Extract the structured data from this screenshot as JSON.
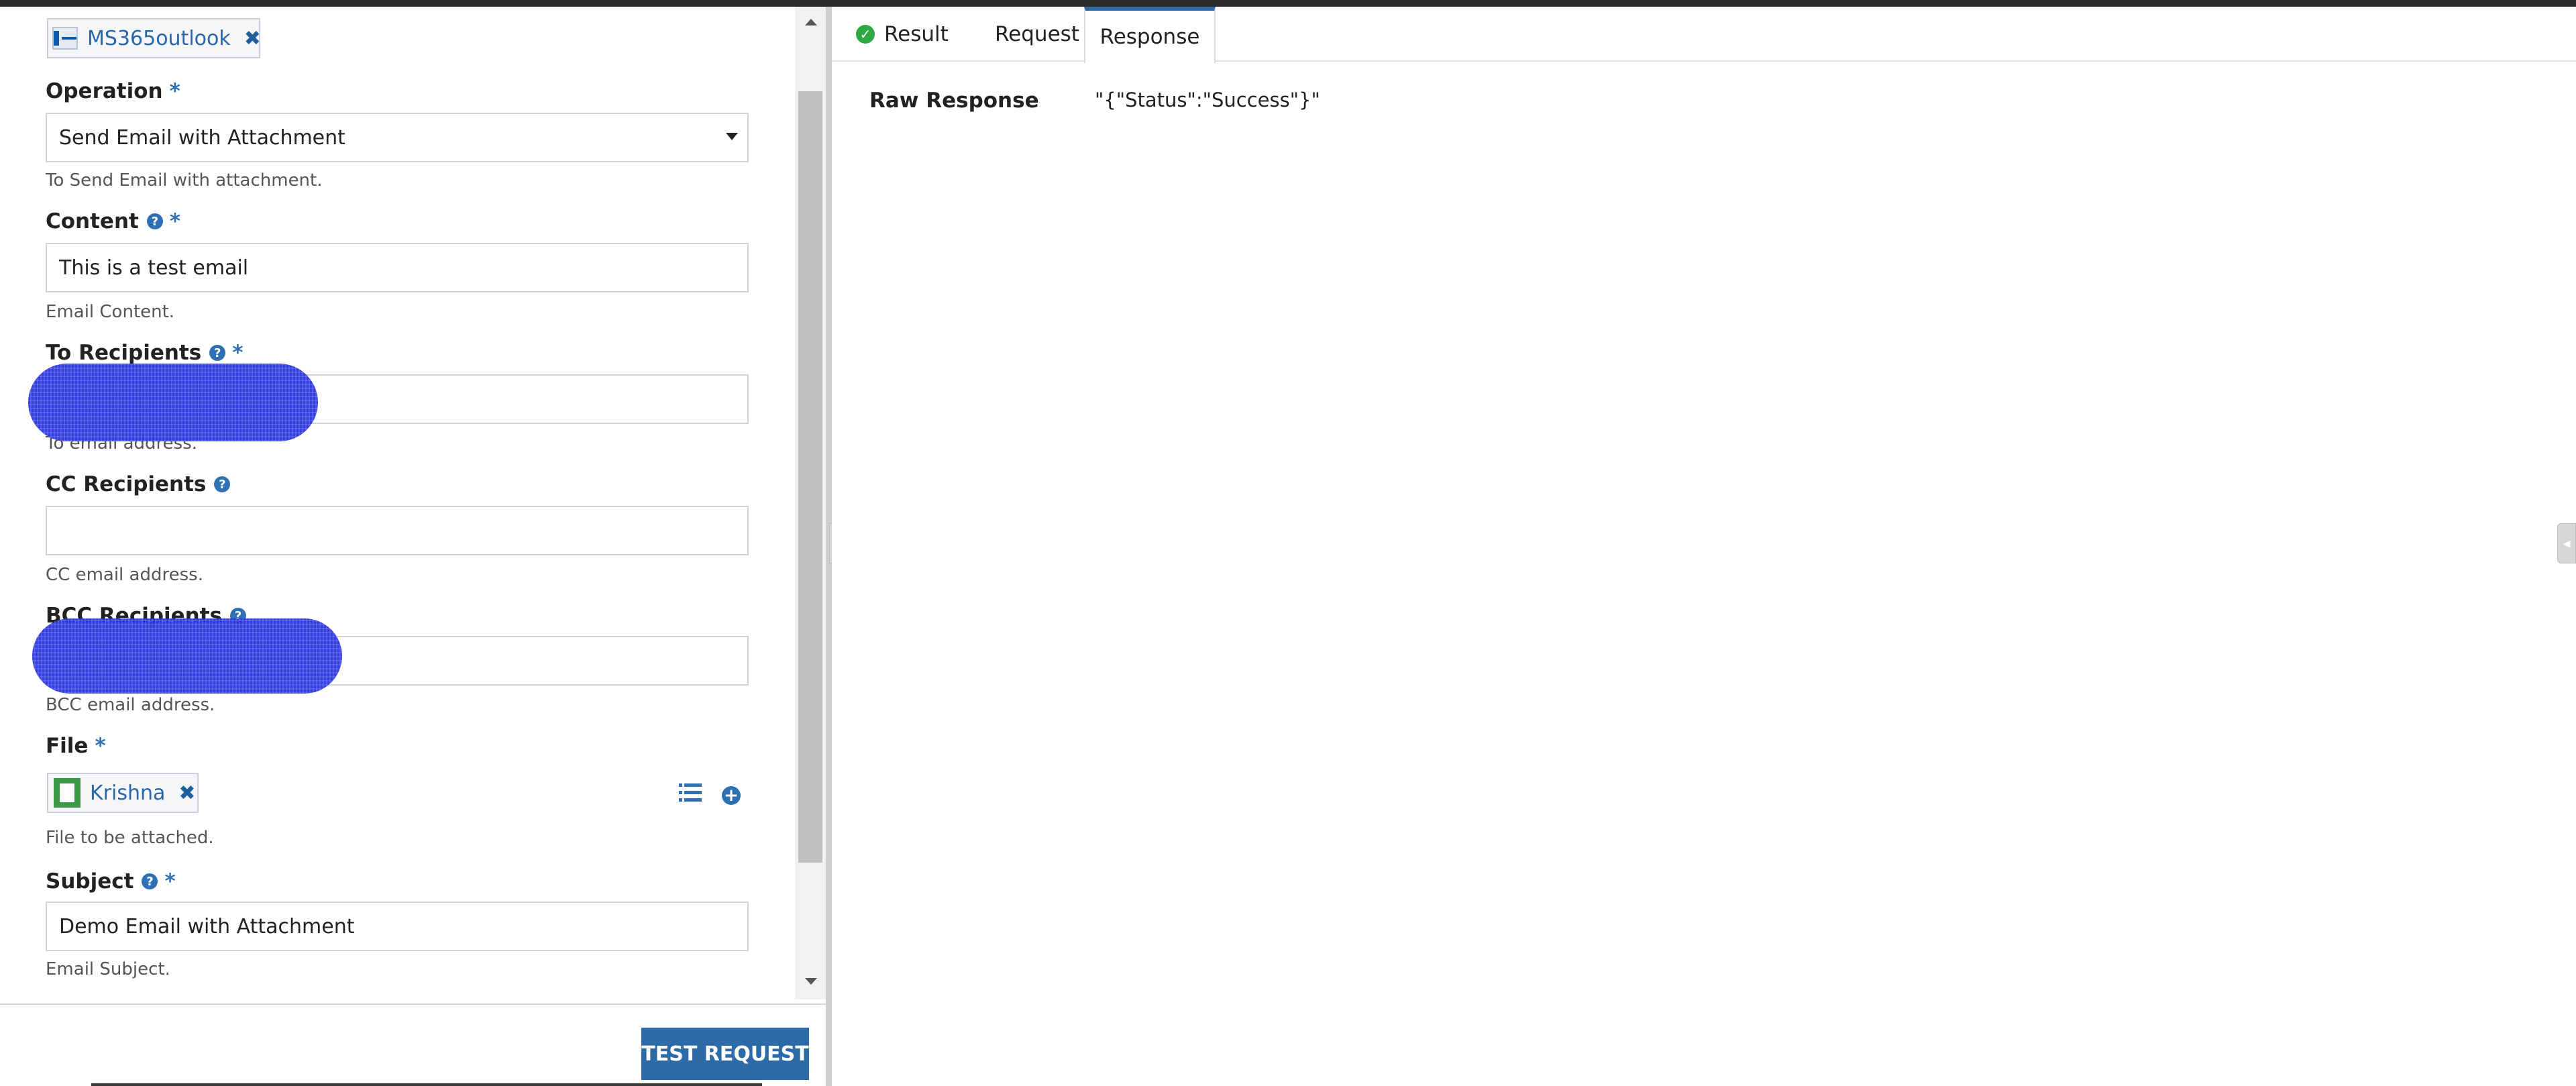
{
  "connection": {
    "label": "MS365outlook",
    "remove_glyph": "✖"
  },
  "fields": [
    {
      "label": "Operation",
      "required": "*",
      "value": "Send Email with Attachment",
      "hint": "To Send Email with attachment."
    },
    {
      "label": "Content",
      "required": "*",
      "value": "This is a test email",
      "hint": "Email Content."
    },
    {
      "label": "To Recipients",
      "required": "*",
      "value": "",
      "hint": "To email address."
    },
    {
      "label": "CC Recipients",
      "value": "",
      "hint": "CC email address."
    },
    {
      "label": "BCC Recipients",
      "value": "",
      "hint": "BCC email address."
    },
    {
      "label": "File",
      "required": "*",
      "attachment": "Krishna",
      "hint": "File to be attached."
    },
    {
      "label": "Subject",
      "required": "*",
      "value": "Demo Email with Attachment",
      "hint": "Email Subject."
    }
  ],
  "help_glyph": "?",
  "footer": {
    "test_button": "TEST REQUEST"
  },
  "tabs": [
    {
      "label": "Result",
      "icon": "check-circle-icon",
      "status_color": "#2fa843"
    },
    {
      "label": "Request"
    },
    {
      "label": "Response",
      "active": true
    }
  ],
  "response": {
    "raw_label": "Raw Response",
    "raw_value": "\"{\"Status\":\"Success\"}\""
  },
  "colors": {
    "accent": "#2d6aa8",
    "success": "#2fa843",
    "redaction": "#2b35d8"
  }
}
